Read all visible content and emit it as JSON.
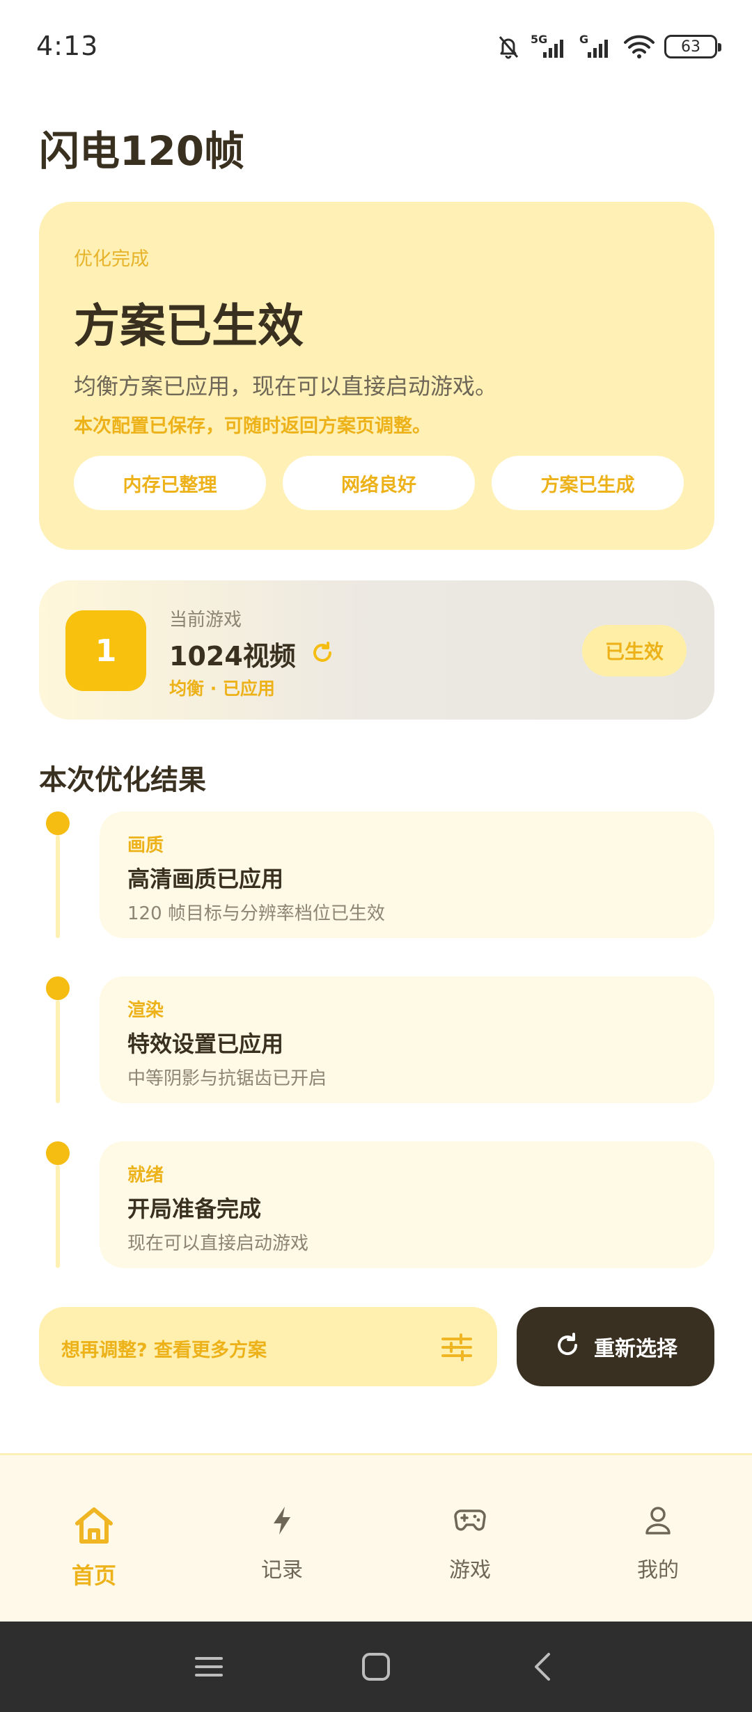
{
  "status_bar": {
    "time": "4:13",
    "network_1": "5G",
    "network_2": "G",
    "battery": "63"
  },
  "page_title": "闪电120帧",
  "hero": {
    "kicker": "优化完成",
    "heading": "方案已生效",
    "description": "均衡方案已应用，现在可以直接启动游戏。",
    "note": "本次配置已保存，可随时返回方案页调整。",
    "chips": [
      "内存已整理",
      "网络良好",
      "方案已生成"
    ]
  },
  "current_game": {
    "label": "当前游戏",
    "badge": "1",
    "name": "1024视频",
    "meta": "均衡 · 已应用",
    "status": "已生效"
  },
  "results": {
    "title": "本次优化结果",
    "items": [
      {
        "tag": "画质",
        "heading": "高清画质已应用",
        "description": "120 帧目标与分辨率档位已生效"
      },
      {
        "tag": "渲染",
        "heading": "特效设置已应用",
        "description": "中等阴影与抗锯齿已开启"
      },
      {
        "tag": "就绪",
        "heading": "开局准备完成",
        "description": "现在可以直接启动游戏"
      }
    ]
  },
  "actions": {
    "adjust_label": "想再调整? 查看更多方案",
    "reselect_label": "重新选择"
  },
  "bottom_nav": {
    "items": [
      {
        "label": "首页",
        "icon": "home-icon",
        "active": true
      },
      {
        "label": "记录",
        "icon": "lightning-icon",
        "active": false
      },
      {
        "label": "游戏",
        "icon": "gamepad-icon",
        "active": false
      },
      {
        "label": "我的",
        "icon": "user-icon",
        "active": false
      }
    ]
  },
  "colors": {
    "accent": "#F8C10D",
    "accent_text": "#EDB21A",
    "hero_bg": "#FFF0B5",
    "dark_button": "#3A3022",
    "text_primary": "#3A3020"
  }
}
